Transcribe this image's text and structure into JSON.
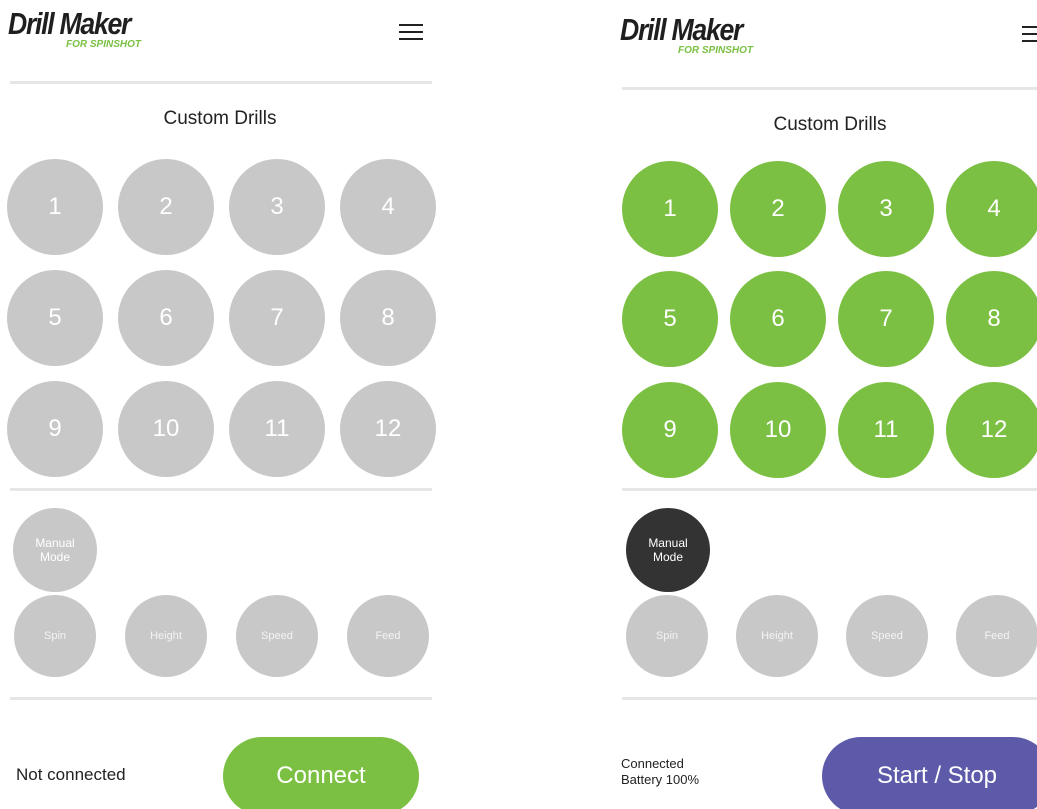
{
  "colors": {
    "green": "#7bc043",
    "gray": "#c8c8c8",
    "dark": "#333333",
    "purple": "#5d5aa9"
  },
  "left_screen": {
    "logo": {
      "title": "Drill Maker",
      "subtitle": "FOR SPINSHOT"
    },
    "menu_icon": "hamburger-icon",
    "section_title": "Custom Drills",
    "drills": [
      "1",
      "2",
      "3",
      "4",
      "5",
      "6",
      "7",
      "8",
      "9",
      "10",
      "11",
      "12"
    ],
    "manual_mode": "Manual\nMode",
    "params": [
      "Spin",
      "Height",
      "Speed",
      "Feed"
    ],
    "status": "Not connected",
    "button": "Connect"
  },
  "right_screen": {
    "logo": {
      "title": "Drill Maker",
      "subtitle": "FOR SPINSHOT"
    },
    "menu_icon": "hamburger-icon",
    "section_title": "Custom Drills",
    "drills": [
      "1",
      "2",
      "3",
      "4",
      "5",
      "6",
      "7",
      "8",
      "9",
      "10",
      "11",
      "12"
    ],
    "manual_mode": "Manual\nMode",
    "params": [
      "Spin",
      "Height",
      "Speed",
      "Feed"
    ],
    "status_line1": "Connected",
    "status_line2": "Battery 100%",
    "button": "Start / Stop"
  }
}
